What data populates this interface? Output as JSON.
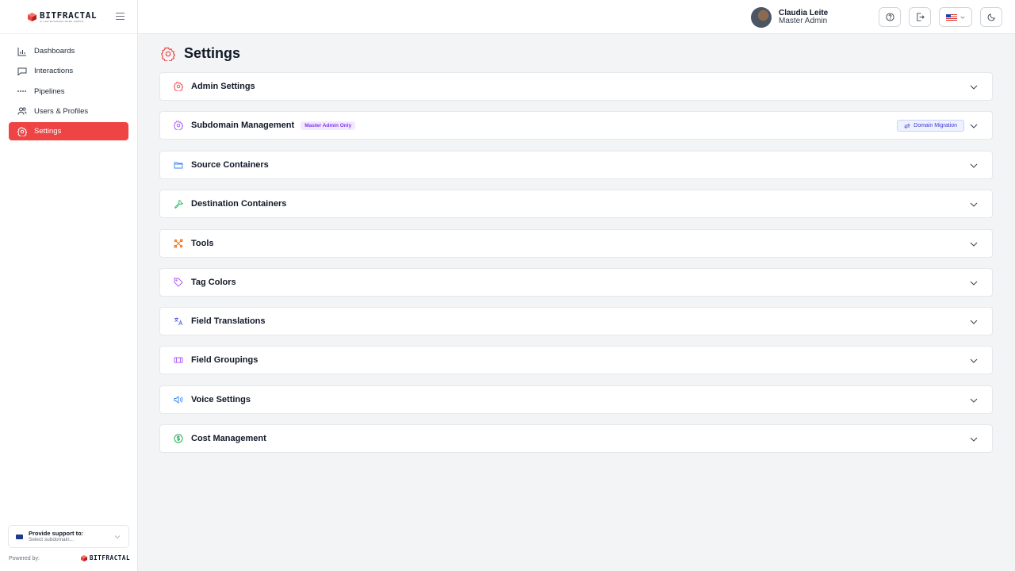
{
  "brand": {
    "name": "BITFRACTAL",
    "tagline": "AI FOR BUSINESS MADE SIMPLE",
    "color": "#ef4444"
  },
  "sidebar": {
    "items": [
      {
        "label": "Dashboards",
        "icon": "bar-chart-icon"
      },
      {
        "label": "Interactions",
        "icon": "chat-icon"
      },
      {
        "label": "Pipelines",
        "icon": "dashed-line-icon"
      },
      {
        "label": "Users & Profiles",
        "icon": "users-icon"
      },
      {
        "label": "Settings",
        "icon": "gear-icon",
        "active": true
      }
    ],
    "support": {
      "title": "Provide support to:",
      "placeholder": "Select subdomain..."
    },
    "powered_by": "Powered by:"
  },
  "header": {
    "user_name": "Claudia Leite",
    "user_role": "Master Admin",
    "buttons": [
      "help-icon",
      "logout-icon",
      "language-flag",
      "moon-icon"
    ]
  },
  "page": {
    "title": "Settings",
    "sections": [
      {
        "title": "Admin Settings",
        "icon": "gear-icon",
        "color": "#ef4444"
      },
      {
        "title": "Subdomain Management",
        "icon": "gear-icon",
        "color": "#a855f7",
        "badge": "Master Admin Only",
        "action": "Domain Migration"
      },
      {
        "title": "Source Containers",
        "icon": "folder-icon",
        "color": "#3b82f6"
      },
      {
        "title": "Destination Containers",
        "icon": "wrench-icon",
        "color": "#22c55e"
      },
      {
        "title": "Tools",
        "icon": "tools-icon",
        "color": "#f97316"
      },
      {
        "title": "Tag Colors",
        "icon": "tag-icon",
        "color": "#a855f7"
      },
      {
        "title": "Field Translations",
        "icon": "translate-icon",
        "color": "#6366f1"
      },
      {
        "title": "Field Groupings",
        "icon": "group-icon",
        "color": "#a855f7"
      },
      {
        "title": "Voice Settings",
        "icon": "speaker-icon",
        "color": "#3b82f6"
      },
      {
        "title": "Cost Management",
        "icon": "dollar-icon",
        "color": "#16a34a"
      }
    ]
  }
}
